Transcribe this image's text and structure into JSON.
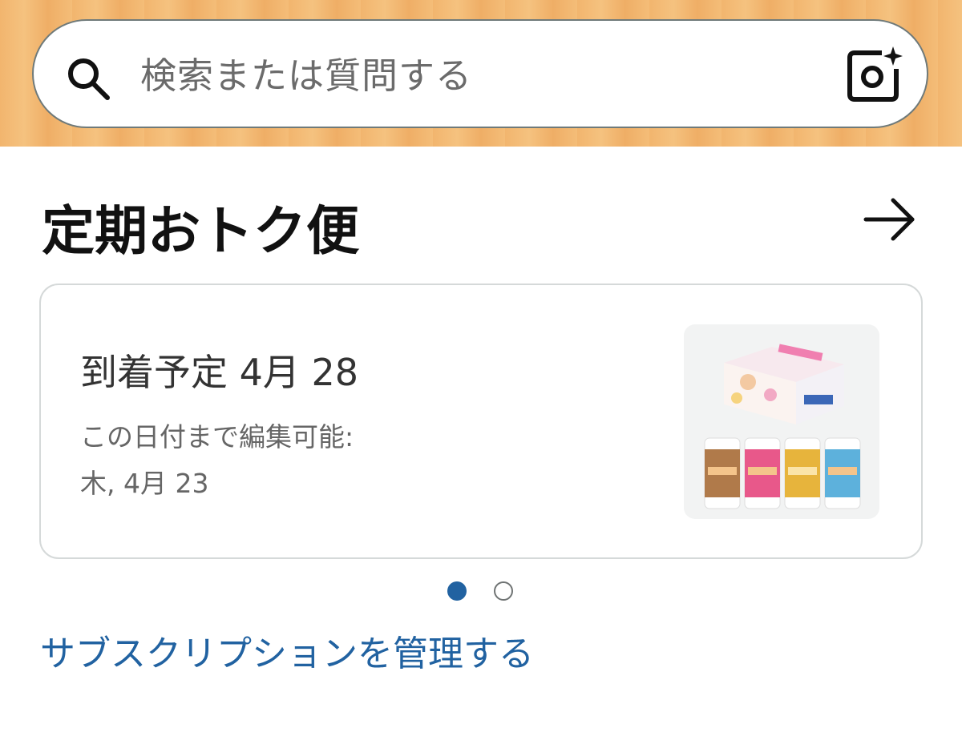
{
  "search": {
    "placeholder": "検索または質問する",
    "icon": "search-icon",
    "camera_icon": "camera-sparkle-icon"
  },
  "section": {
    "title": "定期おトク便",
    "arrow_icon": "arrow-right-icon"
  },
  "subscription_card": {
    "delivery": "到着予定 4月 28",
    "edit_label": "この日付まで編集可能:",
    "edit_date": "木, 4月 23",
    "product_image": "product-box-and-cups-image"
  },
  "carousel": {
    "total": 2,
    "active": 1
  },
  "manage_link": "サブスクリプションを管理する",
  "colors": {
    "accent": "#2162a1",
    "header_bg": "#f2b56e",
    "text_primary": "#111111",
    "text_secondary": "#666666"
  }
}
